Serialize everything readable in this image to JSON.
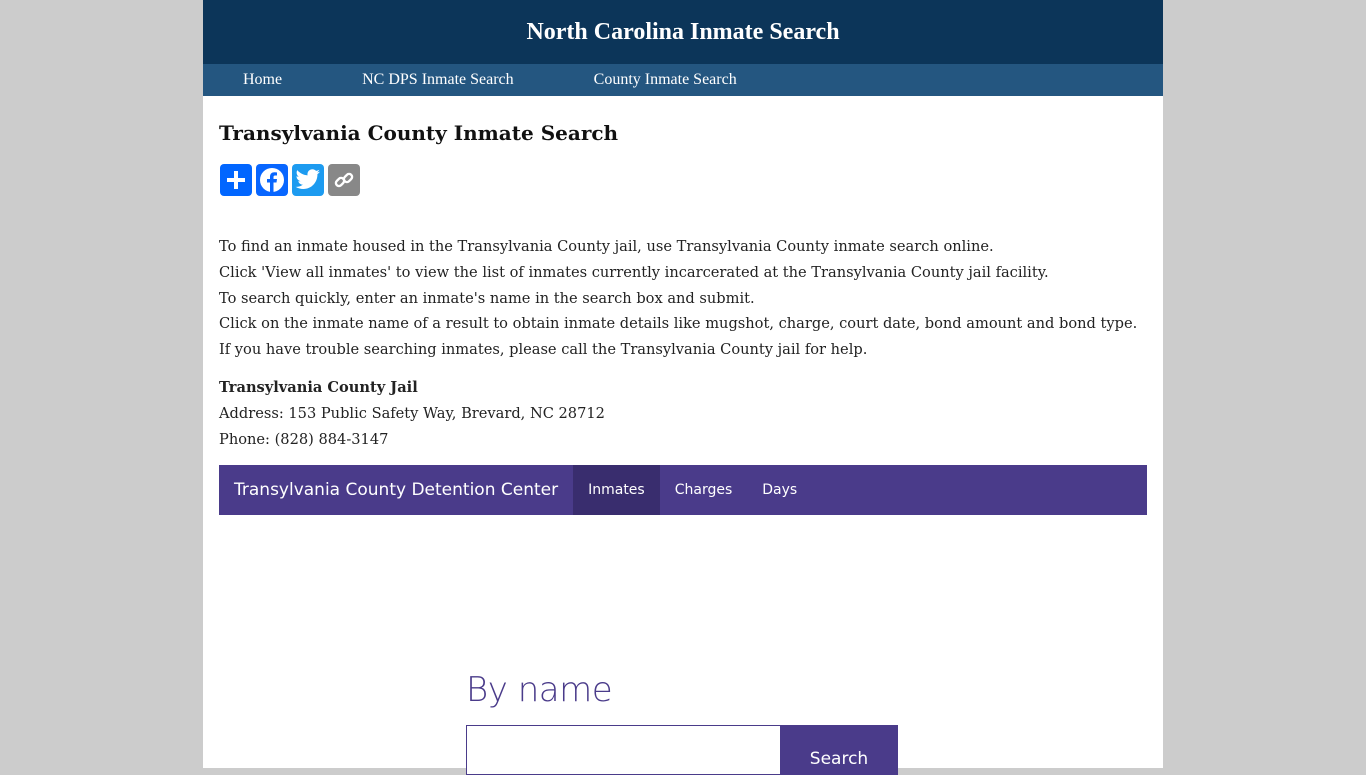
{
  "header": {
    "title": "North Carolina Inmate Search"
  },
  "topnav": {
    "items": [
      {
        "label": "Home"
      },
      {
        "label": "NC DPS Inmate Search"
      },
      {
        "label": "County Inmate Search"
      }
    ]
  },
  "main": {
    "title": "Transylvania County Inmate Search",
    "share_buttons": [
      {
        "name": "share-add",
        "icon": "plus-icon",
        "color": "#0166ff"
      },
      {
        "name": "share-facebook",
        "icon": "facebook-icon",
        "color": "#0866ff"
      },
      {
        "name": "share-twitter",
        "icon": "twitter-icon",
        "color": "#1d9bf0"
      },
      {
        "name": "copy-link",
        "icon": "link-icon",
        "color": "#888888"
      }
    ],
    "intro_lines": [
      "To find an inmate housed in the Transylvania County jail, use Transylvania County inmate search online.",
      "Click 'View all inmates' to view the list of inmates currently incarcerated at the Transylvania County jail facility.",
      "To search quickly, enter an inmate's name in the search box and submit.",
      "Click on the inmate name of a result to obtain inmate details like mugshot, charge, court date, bond amount and bond type.",
      "If you have trouble searching inmates, please call the Transylvania County jail for help."
    ],
    "jail": {
      "name": "Transylvania County Jail",
      "address": "Address: 153 Public Safety Way, Brevard, NC 28712",
      "phone": "Phone: (828) 884-3147"
    }
  },
  "detention_nav": {
    "brand": "Transylvania County Detention Center",
    "tabs": [
      {
        "label": "Inmates",
        "active": true
      },
      {
        "label": "Charges",
        "active": false
      },
      {
        "label": "Days",
        "active": false
      }
    ],
    "color": "#4a3b8a"
  },
  "search": {
    "heading": "By name",
    "input_value": "",
    "button_label": "Search"
  }
}
